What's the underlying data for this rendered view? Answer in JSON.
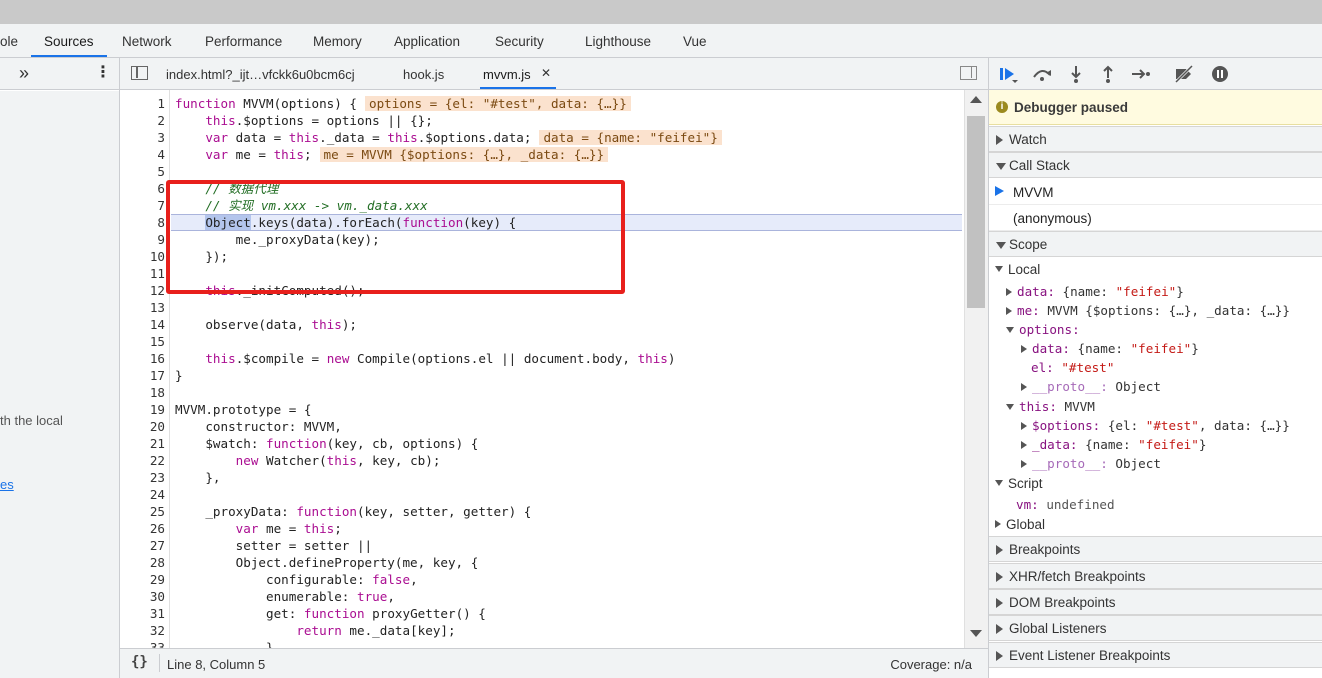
{
  "panel_tabs": [
    {
      "label": "ole"
    },
    {
      "label": "Sources"
    },
    {
      "label": "Network"
    },
    {
      "label": "Performance"
    },
    {
      "label": "Memory"
    },
    {
      "label": "Application"
    },
    {
      "label": "Security"
    },
    {
      "label": "Lighthouse"
    },
    {
      "label": "Vue"
    }
  ],
  "navigator": {
    "more_label": "»",
    "menu_label": "⋮",
    "partial_text": "th the local",
    "partial_link": "es"
  },
  "editor": {
    "file_tabs": [
      {
        "label": "index.html?_ijt…vfckk6u0bcm6cj"
      },
      {
        "label": "hook.js"
      },
      {
        "label": "mvvm.js"
      }
    ],
    "close_glyph": "✕",
    "status": {
      "braces": "{}",
      "position": "Line 8, Column 5",
      "coverage": "Coverage: n/a"
    },
    "lines": [
      {
        "n": "1",
        "c": "function MVVM(options) {",
        "inline": "options = {el: \"#test\", data: {…}}"
      },
      {
        "n": "2",
        "c": "    this.$options = options || {};",
        "inline": ""
      },
      {
        "n": "3",
        "c": "    var data = this._data = this.$options.data;",
        "inline": "data = {name: \"feifei\"}"
      },
      {
        "n": "4",
        "c": "    var me = this;",
        "inline": "me = MVVM {$options: {…}, _data: {…}}"
      },
      {
        "n": "5",
        "c": "",
        "inline": ""
      },
      {
        "n": "6",
        "c": "    // 数据代理",
        "inline": ""
      },
      {
        "n": "7",
        "c": "    // 实现 vm.xxx -> vm._data.xxx",
        "inline": ""
      },
      {
        "n": "8",
        "c": "    Object.keys(data).forEach(function(key) {",
        "inline": ""
      },
      {
        "n": "9",
        "c": "        me._proxyData(key);",
        "inline": ""
      },
      {
        "n": "10",
        "c": "    });",
        "inline": ""
      },
      {
        "n": "11",
        "c": "",
        "inline": ""
      },
      {
        "n": "12",
        "c": "    this._initComputed();",
        "inline": ""
      },
      {
        "n": "13",
        "c": "",
        "inline": ""
      },
      {
        "n": "14",
        "c": "    observe(data, this);",
        "inline": ""
      },
      {
        "n": "15",
        "c": "",
        "inline": ""
      },
      {
        "n": "16",
        "c": "    this.$compile = new Compile(options.el || document.body, this)",
        "inline": ""
      },
      {
        "n": "17",
        "c": "}",
        "inline": ""
      },
      {
        "n": "18",
        "c": "",
        "inline": ""
      },
      {
        "n": "19",
        "c": "MVVM.prototype = {",
        "inline": ""
      },
      {
        "n": "20",
        "c": "    constructor: MVVM,",
        "inline": ""
      },
      {
        "n": "21",
        "c": "    $watch: function(key, cb, options) {",
        "inline": ""
      },
      {
        "n": "22",
        "c": "        new Watcher(this, key, cb);",
        "inline": ""
      },
      {
        "n": "23",
        "c": "    },",
        "inline": ""
      },
      {
        "n": "24",
        "c": "",
        "inline": ""
      },
      {
        "n": "25",
        "c": "    _proxyData: function(key, setter, getter) {",
        "inline": ""
      },
      {
        "n": "26",
        "c": "        var me = this;",
        "inline": ""
      },
      {
        "n": "27",
        "c": "        setter = setter ||",
        "inline": ""
      },
      {
        "n": "28",
        "c": "        Object.defineProperty(me, key, {",
        "inline": ""
      },
      {
        "n": "29",
        "c": "            configurable: false,",
        "inline": ""
      },
      {
        "n": "30",
        "c": "            enumerable: true,",
        "inline": ""
      },
      {
        "n": "31",
        "c": "            get: function proxyGetter() {",
        "inline": ""
      },
      {
        "n": "32",
        "c": "                return me._data[key];",
        "inline": ""
      },
      {
        "n": "33",
        "c": "            }",
        "inline": ""
      }
    ]
  },
  "debugger": {
    "paused_icon": "i",
    "paused_label": "Debugger paused",
    "watch_label": "Watch",
    "callstack_label": "Call Stack",
    "callstack": [
      {
        "label": "MVVM"
      },
      {
        "label": "(anonymous)"
      }
    ],
    "scope_label": "Scope",
    "scope": {
      "local_label": "Local",
      "data_key": "data:",
      "data_val_pre": "{name: ",
      "data_val_str": "\"feifei\"",
      "data_val_post": "}",
      "me_key": "me:",
      "me_val": "MVVM {$options: {…}, _data: {…}}",
      "options_key": "options:",
      "opt_data_key": "data:",
      "opt_data_pre": "{name: ",
      "opt_data_str": "\"feifei\"",
      "opt_data_post": "}",
      "el_key": "el:",
      "el_val": "\"#test\"",
      "proto_key": "__proto__:",
      "proto_val": "Object",
      "this_key": "this:",
      "this_val": "MVVM",
      "this_opts_key": "$options:",
      "this_opts_pre": "{el: ",
      "this_opts_str": "\"#test\"",
      "this_opts_post": ", data: {…}}",
      "this_data_key": "_data:",
      "this_data_pre": "{name: ",
      "this_data_str": "\"feifei\"",
      "this_data_post": "}",
      "this_proto_key": "__proto__:",
      "this_proto_val": "Object",
      "script_label": "Script",
      "vm_key": "vm:",
      "vm_val": "undefined",
      "global_label": "Global"
    },
    "sections": [
      {
        "label": "Breakpoints"
      },
      {
        "label": "XHR/fetch Breakpoints"
      },
      {
        "label": "DOM Breakpoints"
      },
      {
        "label": "Global Listeners"
      },
      {
        "label": "Event Listener Breakpoints"
      }
    ]
  }
}
